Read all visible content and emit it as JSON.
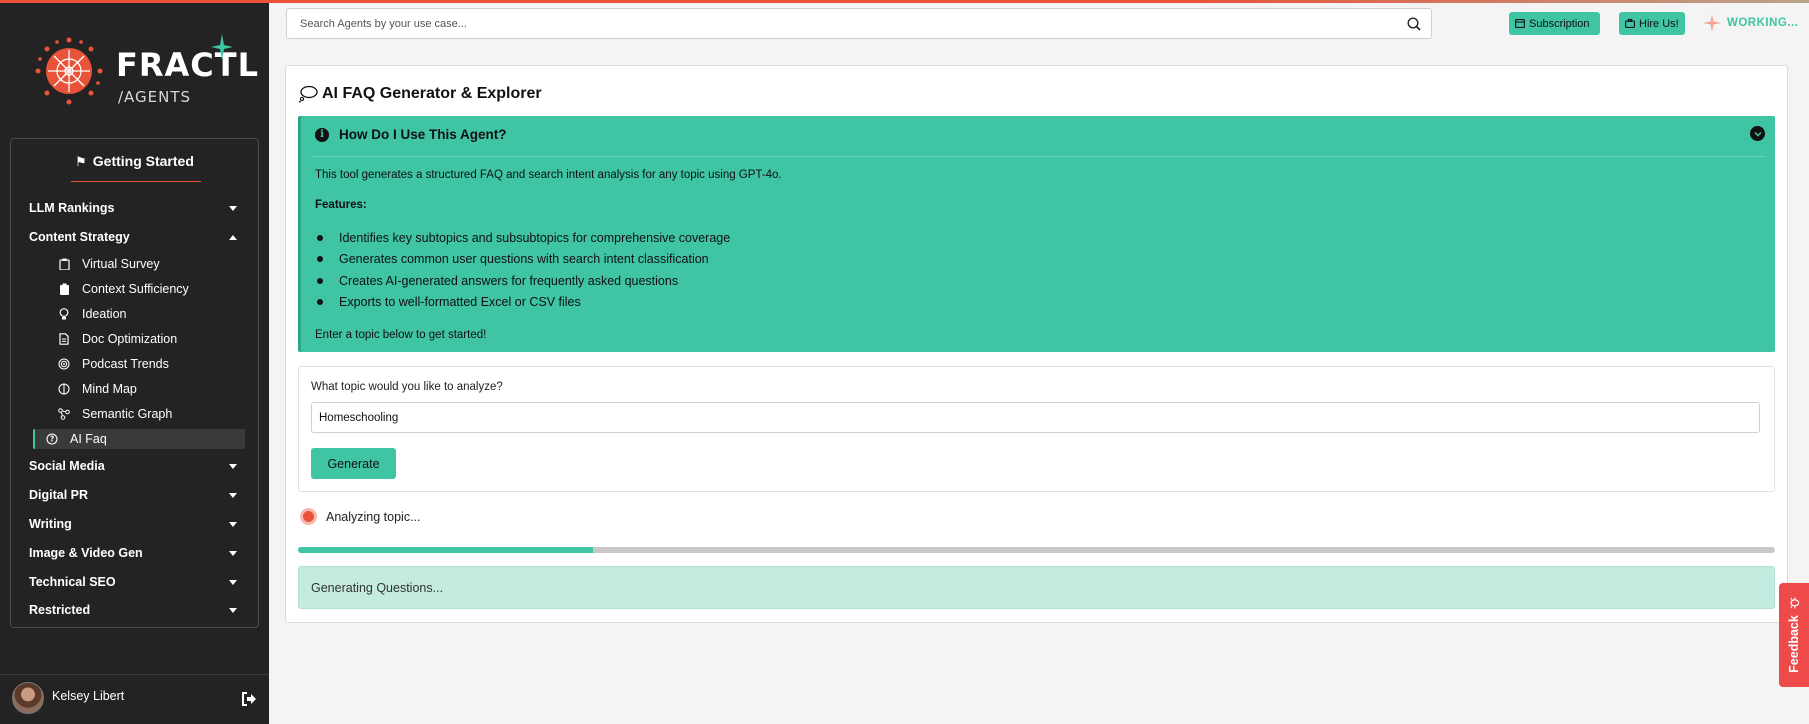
{
  "brand": {
    "name": "FRACTL",
    "sub": "/AGENTS"
  },
  "sidebar": {
    "heading": "Getting Started",
    "sections": [
      {
        "label": "LLM Rankings",
        "expanded": false
      },
      {
        "label": "Content Strategy",
        "expanded": true
      },
      {
        "label": "Social Media",
        "expanded": false
      },
      {
        "label": "Digital PR",
        "expanded": false
      },
      {
        "label": "Writing",
        "expanded": false
      },
      {
        "label": "Image & Video Gen",
        "expanded": false
      },
      {
        "label": "Technical SEO",
        "expanded": false
      },
      {
        "label": "Restricted",
        "expanded": false
      }
    ],
    "content_strategy_items": [
      {
        "label": "Virtual Survey",
        "icon": "clipboard-icon"
      },
      {
        "label": "Context Sufficiency",
        "icon": "clipboard-check-icon"
      },
      {
        "label": "Ideation",
        "icon": "lightbulb-icon"
      },
      {
        "label": "Doc Optimization",
        "icon": "document-icon"
      },
      {
        "label": "Podcast Trends",
        "icon": "podcast-icon"
      },
      {
        "label": "Mind Map",
        "icon": "brain-icon"
      },
      {
        "label": "Semantic Graph",
        "icon": "graph-icon"
      },
      {
        "label": "AI Faq",
        "icon": "question-circle-icon",
        "active": true
      }
    ],
    "user": {
      "name": "Kelsey Libert"
    }
  },
  "topbar": {
    "search_placeholder": "Search Agents by your use case...",
    "subscription_label": "Subscription",
    "hire_label": "Hire Us!",
    "status_label": "WORKING..."
  },
  "main": {
    "title": "AI FAQ Generator & Explorer",
    "howto": {
      "heading": "How Do I Use This Agent?",
      "description": "This tool generates a structured FAQ and search intent analysis for any topic using GPT-4o.",
      "features_label": "Features:",
      "features": [
        "Identifies key subtopics and subsubtopics for comprehensive coverage",
        "Generates common user questions with search intent classification",
        "Creates AI-generated answers for frequently asked questions",
        "Exports to well-formatted Excel or CSV files"
      ],
      "footer": "Enter a topic below to get started!"
    },
    "form": {
      "label": "What topic would you like to analyze?",
      "value": "Homeschooling",
      "button": "Generate"
    },
    "status_text": "Analyzing topic...",
    "progress": 0.2,
    "generating_text": "Generating Questions..."
  },
  "feedback_label": "Feedback",
  "colors": {
    "accent": "#3fc4a4",
    "brand_orange": "#e8533a",
    "sidebar_bg": "#232323"
  }
}
